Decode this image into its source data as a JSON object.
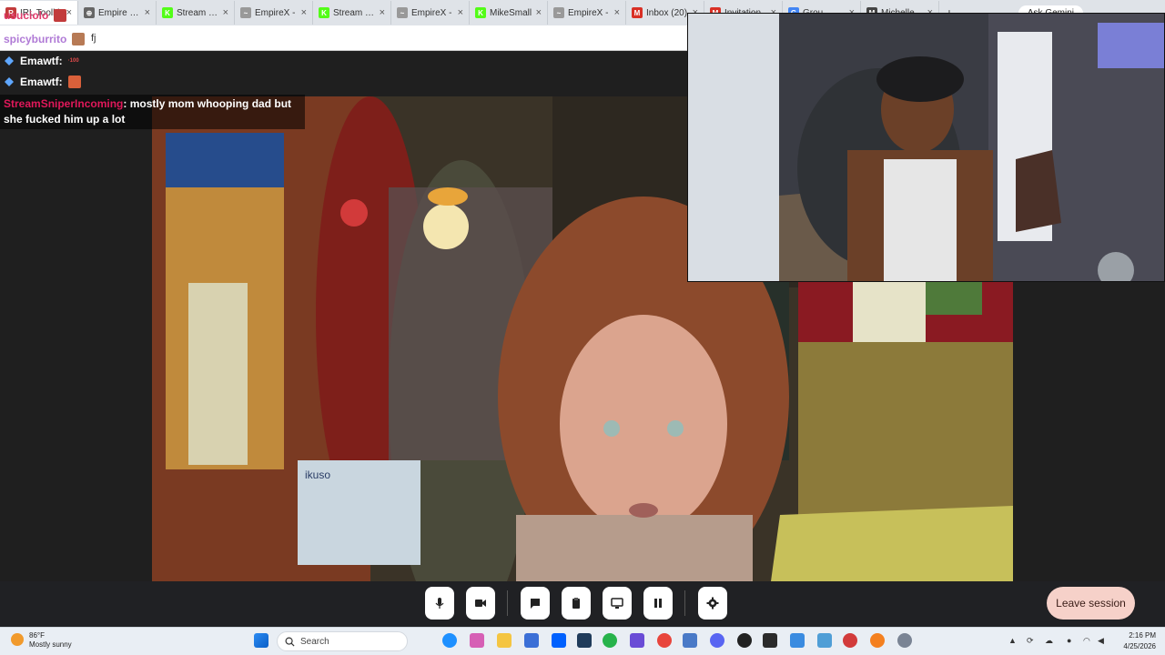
{
  "browser": {
    "tabs": [
      {
        "label": "IRL Toolkit",
        "fav": "#c23b3b",
        "fav_text": "R"
      },
      {
        "label": "Empire X -",
        "fav": "#666666",
        "fav_text": "⊕"
      },
      {
        "label": "Stream - K",
        "fav": "#53fc18",
        "fav_text": "K"
      },
      {
        "label": "EmpireX -",
        "fav": "#999999",
        "fav_text": "~"
      },
      {
        "label": "Stream - K",
        "fav": "#53fc18",
        "fav_text": "K"
      },
      {
        "label": "EmpireX -",
        "fav": "#999999",
        "fav_text": "~"
      },
      {
        "label": "MikeSmall",
        "fav": "#53fc18",
        "fav_text": "K"
      },
      {
        "label": "EmpireX -",
        "fav": "#999999",
        "fav_text": "~"
      },
      {
        "label": "Inbox (20)",
        "fav": "#d93025",
        "fav_text": "M"
      },
      {
        "label": "Invitation",
        "fav": "#d93025",
        "fav_text": "M"
      },
      {
        "label": "Grou",
        "fav": "#4285f4",
        "fav_text": "G"
      },
      {
        "label": "Michelle",
        "fav": "#444444",
        "fav_text": "M"
      }
    ],
    "new_tab": "+",
    "ask_gemini": "Ask Gemini",
    "address_text": "fj"
  },
  "chat": {
    "messages": [
      {
        "user": "usuciolo",
        "color": "#e03a6b",
        "text": ""
      },
      {
        "user": "spicyburrito",
        "color": "#b07ad6",
        "text": "fj"
      },
      {
        "user": "Emawtf:",
        "color": "#ffffff",
        "text": ""
      },
      {
        "user": "Emawtf:",
        "color": "#ffffff",
        "text": ""
      },
      {
        "user": "StreamSniperIncoming",
        "color": "#e0185a",
        "text": "mostly mom whooping dad but she fucked him up a lot"
      }
    ]
  },
  "video": {
    "box_brand": "ikuso"
  },
  "controls": {
    "buttons": [
      {
        "name": "mic-button",
        "icon": "mic-icon"
      },
      {
        "name": "camera-button",
        "icon": "video-icon"
      },
      {
        "name": "chat-button",
        "icon": "chat-icon"
      },
      {
        "name": "clipboard-button",
        "icon": "clipboard-icon"
      },
      {
        "name": "screen-share-button",
        "icon": "screen-icon"
      },
      {
        "name": "pause-button",
        "icon": "pause-icon"
      },
      {
        "name": "settings-button",
        "icon": "gear-icon"
      }
    ],
    "leave_label": "Leave session"
  },
  "taskbar": {
    "weather_temp": "86°F",
    "weather_desc": "Mostly sunny",
    "search_placeholder": "Search",
    "time": "2:16 PM",
    "date": "4/25/2026",
    "colors": {
      "accent": "#0067c0",
      "leave_bg": "#f6d1c9"
    }
  }
}
